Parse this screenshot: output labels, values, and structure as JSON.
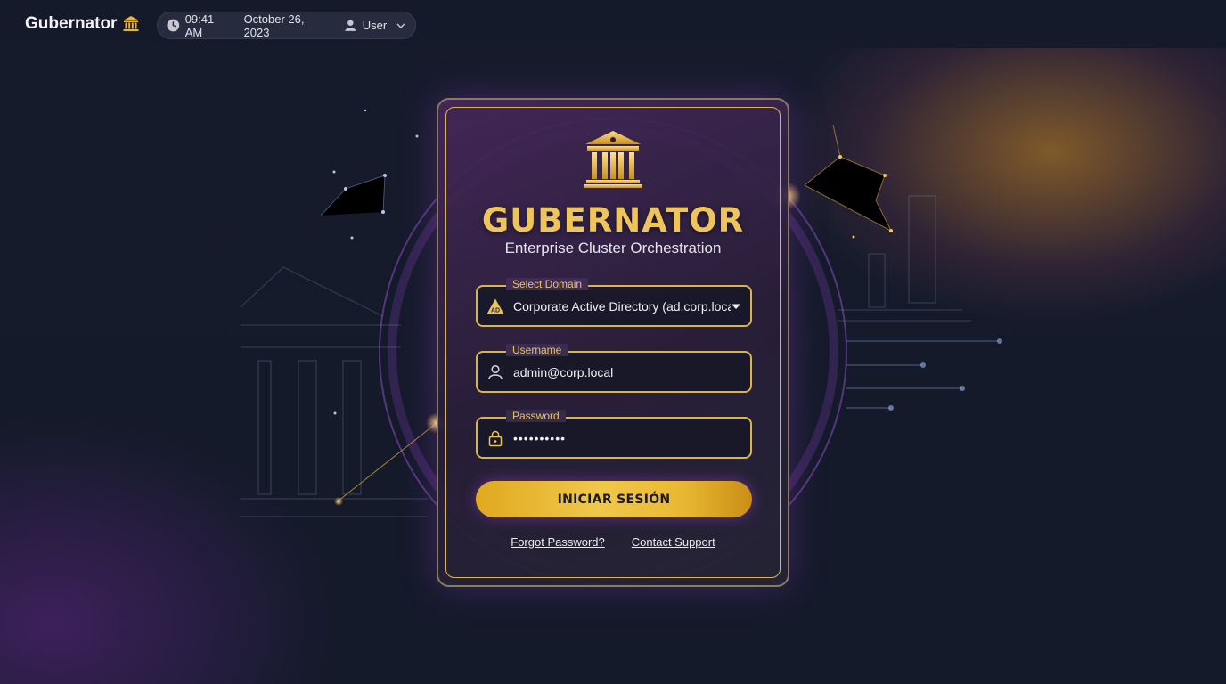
{
  "app": {
    "brand": "Gubernator"
  },
  "topbar": {
    "time": "09:41 AM",
    "date": "October 26, 2023",
    "user": "User"
  },
  "login": {
    "title": "GUBERNATOR",
    "subtitle": "Enterprise Cluster Orchestration",
    "domain": {
      "label": "Select Domain",
      "value": "Corporate Active Directory (ad.corp.local)",
      "icon": "ad-warning-icon"
    },
    "username": {
      "label": "Username",
      "value": "admin@corp.local",
      "icon": "user-icon"
    },
    "password": {
      "label": "Password",
      "value": "••••••••••",
      "icon": "lock-icon"
    },
    "submit_label": "INICIAR SESIÓN",
    "forgot_label": "Forgot Password?",
    "support_label": "Contact Support"
  },
  "colors": {
    "accent_gold": "#e9c45d",
    "background": "#141a2a",
    "card_purple": "#46285a"
  }
}
